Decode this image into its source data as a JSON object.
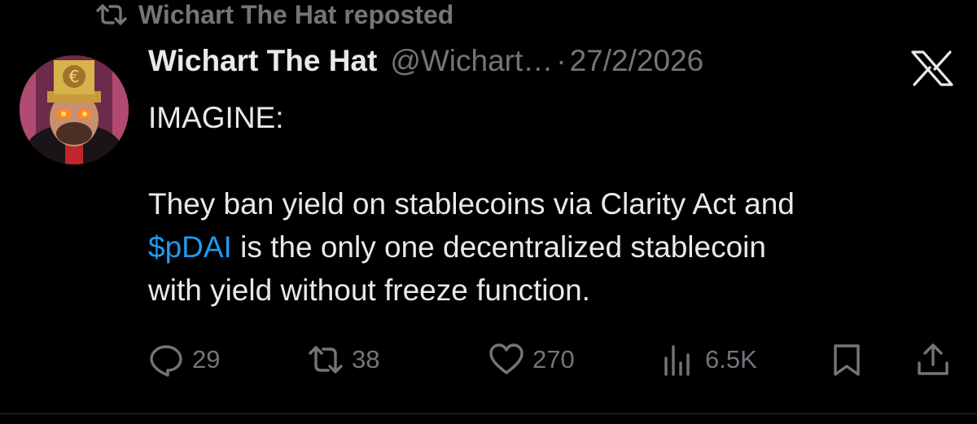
{
  "repost": {
    "text": "Wichart The Hat reposted",
    "icon": "repost-icon"
  },
  "author": {
    "display_name": "Wichart The Hat",
    "handle": "@Wichart…",
    "separator": "·",
    "date": "27/2/2026"
  },
  "post": {
    "line1": "IMAGINE:",
    "line2": "They ban yield on stablecoins via Clarity Act and",
    "cashtag": "$pDAI",
    "line3_rest": " is the only one decentralized stablecoin",
    "line4": "with yield without freeze function."
  },
  "actions": {
    "replies": "29",
    "reposts": "38",
    "likes": "270",
    "views": "6.5K"
  },
  "colors": {
    "background": "#000000",
    "text": "#e7e9ea",
    "muted": "#71767b",
    "link": "#1d9bf0"
  }
}
